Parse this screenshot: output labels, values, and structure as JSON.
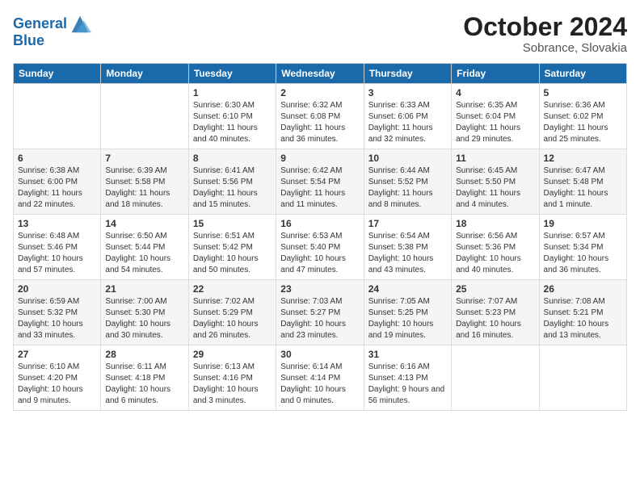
{
  "logo": {
    "line1": "General",
    "line2": "Blue"
  },
  "title": "October 2024",
  "subtitle": "Sobrance, Slovakia",
  "days_of_week": [
    "Sunday",
    "Monday",
    "Tuesday",
    "Wednesday",
    "Thursday",
    "Friday",
    "Saturday"
  ],
  "weeks": [
    [
      {
        "day": "",
        "info": ""
      },
      {
        "day": "",
        "info": ""
      },
      {
        "day": "1",
        "info": "Sunrise: 6:30 AM\nSunset: 6:10 PM\nDaylight: 11 hours and 40 minutes."
      },
      {
        "day": "2",
        "info": "Sunrise: 6:32 AM\nSunset: 6:08 PM\nDaylight: 11 hours and 36 minutes."
      },
      {
        "day": "3",
        "info": "Sunrise: 6:33 AM\nSunset: 6:06 PM\nDaylight: 11 hours and 32 minutes."
      },
      {
        "day": "4",
        "info": "Sunrise: 6:35 AM\nSunset: 6:04 PM\nDaylight: 11 hours and 29 minutes."
      },
      {
        "day": "5",
        "info": "Sunrise: 6:36 AM\nSunset: 6:02 PM\nDaylight: 11 hours and 25 minutes."
      }
    ],
    [
      {
        "day": "6",
        "info": "Sunrise: 6:38 AM\nSunset: 6:00 PM\nDaylight: 11 hours and 22 minutes."
      },
      {
        "day": "7",
        "info": "Sunrise: 6:39 AM\nSunset: 5:58 PM\nDaylight: 11 hours and 18 minutes."
      },
      {
        "day": "8",
        "info": "Sunrise: 6:41 AM\nSunset: 5:56 PM\nDaylight: 11 hours and 15 minutes."
      },
      {
        "day": "9",
        "info": "Sunrise: 6:42 AM\nSunset: 5:54 PM\nDaylight: 11 hours and 11 minutes."
      },
      {
        "day": "10",
        "info": "Sunrise: 6:44 AM\nSunset: 5:52 PM\nDaylight: 11 hours and 8 minutes."
      },
      {
        "day": "11",
        "info": "Sunrise: 6:45 AM\nSunset: 5:50 PM\nDaylight: 11 hours and 4 minutes."
      },
      {
        "day": "12",
        "info": "Sunrise: 6:47 AM\nSunset: 5:48 PM\nDaylight: 11 hours and 1 minute."
      }
    ],
    [
      {
        "day": "13",
        "info": "Sunrise: 6:48 AM\nSunset: 5:46 PM\nDaylight: 10 hours and 57 minutes."
      },
      {
        "day": "14",
        "info": "Sunrise: 6:50 AM\nSunset: 5:44 PM\nDaylight: 10 hours and 54 minutes."
      },
      {
        "day": "15",
        "info": "Sunrise: 6:51 AM\nSunset: 5:42 PM\nDaylight: 10 hours and 50 minutes."
      },
      {
        "day": "16",
        "info": "Sunrise: 6:53 AM\nSunset: 5:40 PM\nDaylight: 10 hours and 47 minutes."
      },
      {
        "day": "17",
        "info": "Sunrise: 6:54 AM\nSunset: 5:38 PM\nDaylight: 10 hours and 43 minutes."
      },
      {
        "day": "18",
        "info": "Sunrise: 6:56 AM\nSunset: 5:36 PM\nDaylight: 10 hours and 40 minutes."
      },
      {
        "day": "19",
        "info": "Sunrise: 6:57 AM\nSunset: 5:34 PM\nDaylight: 10 hours and 36 minutes."
      }
    ],
    [
      {
        "day": "20",
        "info": "Sunrise: 6:59 AM\nSunset: 5:32 PM\nDaylight: 10 hours and 33 minutes."
      },
      {
        "day": "21",
        "info": "Sunrise: 7:00 AM\nSunset: 5:30 PM\nDaylight: 10 hours and 30 minutes."
      },
      {
        "day": "22",
        "info": "Sunrise: 7:02 AM\nSunset: 5:29 PM\nDaylight: 10 hours and 26 minutes."
      },
      {
        "day": "23",
        "info": "Sunrise: 7:03 AM\nSunset: 5:27 PM\nDaylight: 10 hours and 23 minutes."
      },
      {
        "day": "24",
        "info": "Sunrise: 7:05 AM\nSunset: 5:25 PM\nDaylight: 10 hours and 19 minutes."
      },
      {
        "day": "25",
        "info": "Sunrise: 7:07 AM\nSunset: 5:23 PM\nDaylight: 10 hours and 16 minutes."
      },
      {
        "day": "26",
        "info": "Sunrise: 7:08 AM\nSunset: 5:21 PM\nDaylight: 10 hours and 13 minutes."
      }
    ],
    [
      {
        "day": "27",
        "info": "Sunrise: 6:10 AM\nSunset: 4:20 PM\nDaylight: 10 hours and 9 minutes."
      },
      {
        "day": "28",
        "info": "Sunrise: 6:11 AM\nSunset: 4:18 PM\nDaylight: 10 hours and 6 minutes."
      },
      {
        "day": "29",
        "info": "Sunrise: 6:13 AM\nSunset: 4:16 PM\nDaylight: 10 hours and 3 minutes."
      },
      {
        "day": "30",
        "info": "Sunrise: 6:14 AM\nSunset: 4:14 PM\nDaylight: 10 hours and 0 minutes."
      },
      {
        "day": "31",
        "info": "Sunrise: 6:16 AM\nSunset: 4:13 PM\nDaylight: 9 hours and 56 minutes."
      },
      {
        "day": "",
        "info": ""
      },
      {
        "day": "",
        "info": ""
      }
    ]
  ]
}
